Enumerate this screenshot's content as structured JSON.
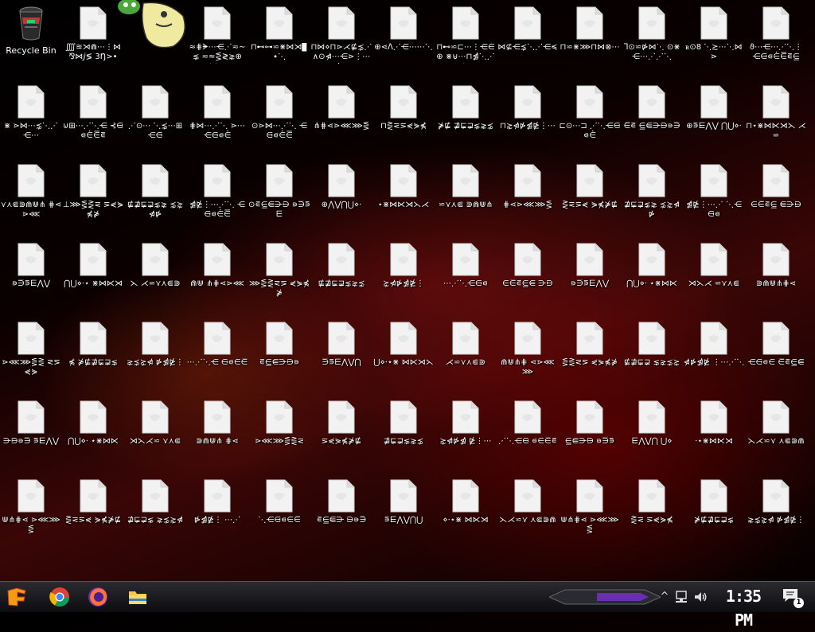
{
  "desktop": {
    "recycle_bin": {
      "label": "Recycle Bin",
      "icon": "recycle-bin-icon"
    },
    "mascot": {
      "icon": "mascot-sticker-icon"
    },
    "file_icon": "blank-file-icon",
    "files": [
      [
        "⨌≋⋊⋒⋯⋮⋈ ⅋⋈ⅉ≶ 3Ŋ>•",
        "≈⋕ᗙ⋯⋲⋰≂∼⋦ ≂≈⋚≷⋧⊕⋉⋯",
        "⊓⊷⊶⋍⋇⋈⋊▊∙⋱ ",
        "⊓⋈⋄⊓⋗⋌⋢⋨⋰ ∧⊙⋪⋯⋲⋗⋮⋯⋱",
        "⊕⋖ᐱ⋰⋲⋯⋯⋱",
        "⊓⊷⋍⊏⋯⋮⋲⋵⊕ ⋇⊎⋯⊓⋬⋱⋰⋨⋯",
        "⋈⊈⋲⋨⋱⋰⋲≼",
        "⊓⋍⋇⋙⊓⋈⊗⋯",
        "ᒣ⊙⋍⋫⋈⋱ ⊙⋇⋲⋯⋰⋰⋱",
        "ꭱ⊙8 ⋱≿⋯⋱⋈⋗",
        "ϑ⋯⋲⋯⋰⋱⋮ ⋲⋳⋴⋵⋶⋷⋸",
        "ỗ⋈⋰⋨⋱⋯ ⋖⋯⋰⋱⋯⋲⋳"
      ],
      [
        "⋇ ⋗⋈⋯⋨⋱⋰⋲⋯",
        "⊍⊞⋯⋰⋱⋲ ⊰⋳⋴⋵⋶⋷",
        "⋰⊙⋯ ⋱⋨⋯⊞⋲⋳",
        "⋕⋈⋯⋰⋱ ⋗⋯⋲⋳⋴⋵",
        "⊙⋗⋈⋯⋰⋱ ⋲⋳⋴⋵⋶",
        "⋔⋕⋖⋗⋘⋙⋚",
        "⊓⋛⋜⋝⋞⋟⋠",
        "⋡⋢ ⋣⋤⋥⋦⋧⋨",
        "⊓⋩⋪⋫⋬⋭⋮⋯",
        "⊏⊙⋯⊐ ⋰⋱⋲⋳⋴⋵",
        "⋶⋷ ⋸⋹⋺⋻⋼⋽",
        "⊕⋾⋿⋀⋁ ⋂⋃⋄⋅",
        "⊓⋆⋇⋈⋉⋊⋋ ⋌⋍"
      ],
      [
        "⋎⋏⋐⋑⋒⋓⋔ ⋕⋖⋗⋘",
        "⊥⋙⋚⋛⋜ ⋝⋞⋟⋠⋡",
        "⋢⋣⋤⋥⋦⋧ ⋨⋩⋪⋫",
        "⋬⋭⋮⋯⋰⋱ ⋲⋳⋴⋵⋶",
        "⊙⋷⋸⋹⋺⋻ ⋼⋽⋾⋿",
        "⊕⋀⋁⋂⋃⋄⋅",
        "⋆⋇⋈⋉⋊⋋⋌",
        "⋍⋎⋏⋐ ⋑⋒⋓⋔",
        "⋕⋖⋗⋘⋙⋚",
        "⋛⋜⋝⋞ ⋟⋠⋡⋢",
        "⋣⋤⋥⋦⋧ ⋨⋩⋪⋫",
        "⋬⋭⋮⋯⋰ ⋱⋲⋳⋴",
        "⋵⋶⋷⋸ ⋹⋺⋻"
      ],
      [
        "⋼⋽⋾⋿⋀⋁",
        "⋂⋃⋄⋅⋆ ⋇⋈⋉⋊",
        "⋋ ⋌⋍⋎⋏⋐⋑",
        "⋒⋓ ⋔⋕⋖⋗⋘",
        "⋙⋚⋛⋜⋝ ⋞⋟⋠⋡",
        "⋢⋣⋤⋥⋦⋧⋨",
        "⋩⋪⋫⋬⋭⋮",
        "⋯⋰⋱⋲⋳⋴",
        "⋵⋶⋷⋸⋹ ⋺⋻",
        "⋼⋽⋾⋿⋀⋁",
        "⋂⋃⋄⋅ ⋆⋇⋈⋉",
        "⋊⋋⋌ ⋍⋎⋏⋐",
        "⋑⋒⋓⋔⋕⋖"
      ],
      [
        "⋗⋘⋙⋚⋛ ⋜⋝⋞⋟",
        "⋠ ⋡⋢⋣⋤⋥⋦",
        "⋧⋨⋩⋪ ⋫⋬⋭⋮",
        "⋯⋰⋱⋲ ⋳⋴⋵⋶",
        "⋷⋸⋹⋺⋻⋼",
        "⋽⋾⋿⋀⋁⋂",
        "⋃⋄⋅⋆⋇ ⋈⋉⋊⋋",
        "⋌⋍⋎⋏⋐⋑",
        "⋒⋓⋔⋕ ⋖⋗⋘⋙",
        "⋚⋛⋜⋝ ⋞⋟⋠⋡",
        "⋢⋣⋤⋥ ⋦⋧⋨⋩",
        "⋪⋫⋬⋭ ⋮⋯⋰⋱",
        "⋲⋳⋴⋵ ⋶⋷⋸⋹"
      ],
      [
        "⋺⋻⋼⋽ ⋾⋿⋀⋁",
        "⋂⋃⋄⋅ ⋆⋇⋈⋉",
        "⋊⋋⋌⋍ ⋎⋏⋐",
        "⋑⋒⋓⋔ ⋕⋖",
        "⋗⋘⋙⋚⋛⋜",
        "⋝⋞⋟⋠⋡⋢",
        "⋣⋤⋥⋦⋧⋨",
        "⋩⋪⋫⋬ ⋭⋮⋯",
        "⋰⋱⋲⋳ ⋴⋵⋶⋷",
        "⋸⋹⋺⋻ ⋼⋽⋾",
        "⋿⋀⋁⋂ ⋃⋄",
        "⋅⋆⋇⋈⋉⋊",
        "⋋⋌⋍⋎ ⋏⋐⋑⋒"
      ],
      [
        "⋓⋔⋕⋖ ⋗⋘⋙⋚",
        "⋛⋜⋝⋞ ⋟⋠⋡⋢",
        "⋣⋤⋥⋦ ⋧⋨⋩⋪",
        "⋫⋬⋭⋮ ⋯⋰",
        "⋱⋲⋳⋴⋵⋶",
        "⋷⋸⋹⋺ ⋻⋼⋽",
        "⋾⋿⋀⋁⋂⋃",
        "⋄⋅⋆⋇ ⋈⋉⋊",
        "⋋⋌⋍⋎ ⋏⋐⋑⋒",
        "⋓⋔⋕⋖ ⋗⋘⋙⋚",
        "⋛⋜ ⋝⋞⋟⋠",
        "⋡⋢⋣⋤⋥⋦",
        "⋧⋨⋩⋪ ⋫⋬⋭⋮"
      ]
    ]
  },
  "taskbar": {
    "start_icon": "start-menu-icon",
    "pinned": [
      {
        "name": "chrome",
        "icon": "chrome-icon"
      },
      {
        "name": "firefox",
        "icon": "firefox-icon"
      },
      {
        "name": "file-explorer",
        "icon": "folder-icon"
      }
    ],
    "tray": {
      "show_hidden_label": "^",
      "network_icon": "network-icon",
      "volume_icon": "volume-icon",
      "clock": "1:35 PM",
      "notifications_badge": "1"
    }
  },
  "colors": {
    "accent_purple": "#6a2fb0",
    "taskbar_bg": "#111114",
    "file_fill": "#f2f2f2"
  }
}
